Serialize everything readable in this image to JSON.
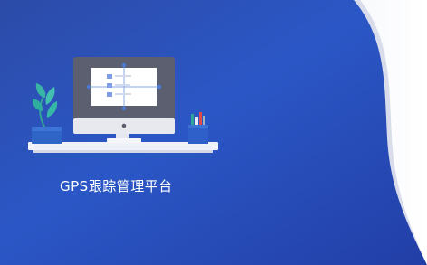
{
  "platform": {
    "title": "GPS跟踪管理平台"
  },
  "theme": {
    "background_gradient": [
      "#2f4ea6",
      "#2c56c7",
      "#1f3c9f"
    ],
    "curve_white": "#ffffff",
    "curve_light": "#d9dcec",
    "monitor_frame": "#5a5d6d",
    "monitor_screen": "#ffffff",
    "desk": "#e9ecf5",
    "plant_leaf": "#34b6a6",
    "plant_pot": "#2e67c7",
    "pen_cup": "#2f5fc9"
  },
  "icons": {
    "monitor": "desktop-monitor-illustration",
    "plant": "potted-plant-illustration",
    "pen_holder": "pen-holder-illustration"
  }
}
